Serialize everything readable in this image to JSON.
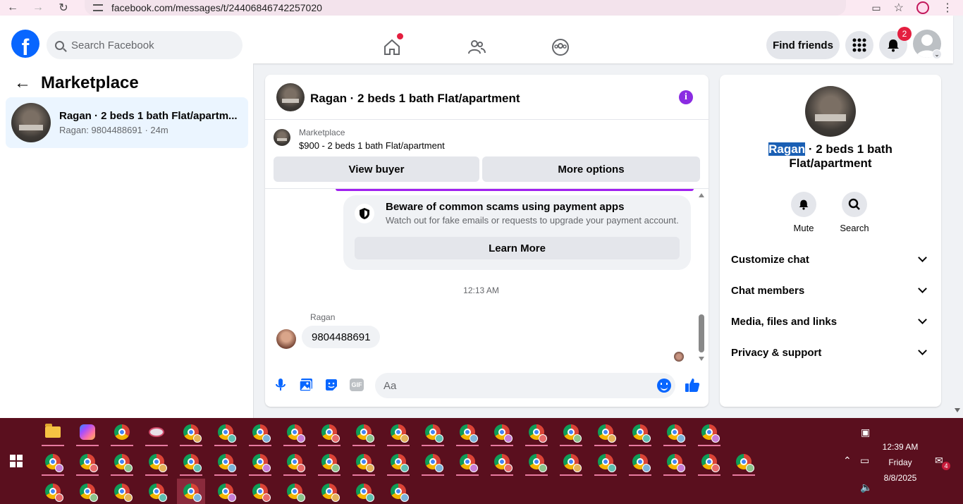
{
  "browser": {
    "url": "facebook.com/messages/t/24406846742257020"
  },
  "fb_header": {
    "search_placeholder": "Search Facebook",
    "find_friends_label": "Find friends",
    "notifications_count": "2"
  },
  "left_panel": {
    "title": "Marketplace",
    "conversations": [
      {
        "title": "Ragan · 2 beds 1 bath Flat/apartm...",
        "preview": "Ragan: 9804488691 · 24m"
      }
    ]
  },
  "chat": {
    "title": "Ragan · 2 beds 1 bath Flat/apartment",
    "marketplace_label": "Marketplace",
    "listing": "$900 - 2 beds 1 bath Flat/apartment",
    "view_buyer_label": "View buyer",
    "more_options_label": "More options",
    "scam_title": "Beware of common scams using payment apps",
    "scam_desc": "Watch out for fake emails or requests to upgrade your payment account.",
    "learn_more_label": "Learn More",
    "timestamp": "12:13 AM",
    "sender_name": "Ragan",
    "message_text": "9804488691",
    "input_placeholder": "Aa"
  },
  "info_panel": {
    "name_highlight": "Ragan",
    "name_rest": " · 2 beds 1 bath Flat/apartment",
    "mute_label": "Mute",
    "search_label": "Search",
    "sections": [
      "Customize chat",
      "Chat members",
      "Media, files and links",
      "Privacy & support"
    ]
  },
  "taskbar": {
    "time": "12:39 AM",
    "day": "Friday",
    "date": "8/8/2025",
    "notification_count": "4"
  },
  "colors": {
    "fb_blue": "#0866ff",
    "accent_purple": "#a020f0",
    "taskbar_bg": "#5a0f1e"
  }
}
